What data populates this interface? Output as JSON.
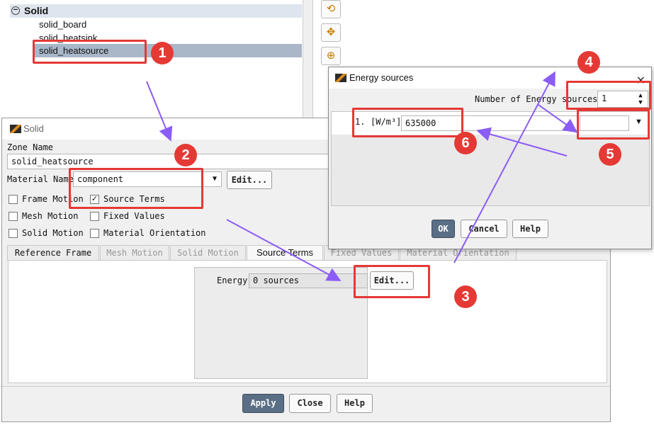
{
  "tree": {
    "parent_label": "Solid",
    "toggle_glyph": "−",
    "items": [
      {
        "label": "solid_board"
      },
      {
        "label": "solid_heatsink"
      },
      {
        "label": "solid_heatsource",
        "selected": true
      }
    ]
  },
  "toolbar": {
    "icons": [
      "rotate-icon",
      "pan-icon",
      "zoom-icon"
    ],
    "glyphs": [
      "⟲",
      "✥",
      "⊕"
    ]
  },
  "solid_dialog": {
    "title": "Solid",
    "zone_name_label": "Zone Name",
    "zone_name_value": "solid_heatsource",
    "material_name_label": "Material Name",
    "material_name_value": "component",
    "edit_label": "Edit...",
    "checkboxes": [
      {
        "label": "Frame Motion",
        "checked": false
      },
      {
        "label": "Source Terms",
        "checked": true
      },
      {
        "label": "Mesh Motion",
        "checked": false
      },
      {
        "label": "Fixed Values",
        "checked": false
      },
      {
        "label": "Solid Motion",
        "checked": false
      },
      {
        "label": "Material Orientation",
        "checked": false
      }
    ],
    "tabs": [
      "Reference Frame",
      "Mesh Motion",
      "Solid Motion",
      "Source Terms",
      "Fixed Values",
      "Material Orientation"
    ],
    "active_tab": "Source Terms",
    "energy_label": "Energy",
    "energy_value": "0 sources",
    "energy_edit_label": "Edit...",
    "buttons": {
      "apply": "Apply",
      "close": "Close",
      "help": "Help"
    }
  },
  "energy_dialog": {
    "title": "Energy sources",
    "close_glyph": "✕",
    "number_label": "Number of Energy sources",
    "number_value": "1",
    "row_index": "1.",
    "unit_label": "[W/m³]",
    "value": "635000",
    "dropdown_value": "",
    "buttons": {
      "ok": "OK",
      "cancel": "Cancel",
      "help": "Help"
    }
  },
  "annotations": {
    "badges": [
      "1",
      "2",
      "3",
      "4",
      "5",
      "6"
    ],
    "color": "#e53935",
    "arrow_color": "#8b5cf6"
  }
}
